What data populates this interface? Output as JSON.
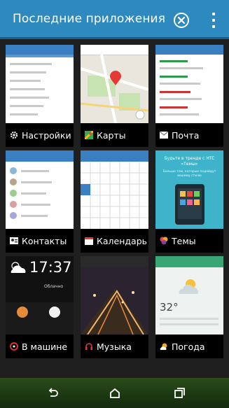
{
  "header": {
    "title": "Последние приложения",
    "close_icon": "close-circle-icon",
    "menu_icon": "more-vertical-icon"
  },
  "apps": [
    {
      "label": "Настройки",
      "icon": "settings-gear-icon",
      "accent": "#3a7fc1"
    },
    {
      "label": "Карты",
      "icon": "maps-icon",
      "accent": "#34a853"
    },
    {
      "label": "Почта",
      "icon": "mail-icon",
      "accent": "#ffffff"
    },
    {
      "label": "Контакты",
      "icon": "contacts-card-icon",
      "accent": "#ffffff"
    },
    {
      "label": "Календарь",
      "icon": "calendar-icon",
      "accent": "#ffffff"
    },
    {
      "label": "Темы",
      "icon": "themes-icon",
      "accent": "#e64a3c"
    },
    {
      "label": "В машине",
      "icon": "car-mode-icon",
      "accent": "#e53935"
    },
    {
      "label": "Музыка",
      "icon": "headphones-icon",
      "accent": "#e53935"
    },
    {
      "label": "Погода",
      "icon": "weather-icon",
      "accent": "#f6a623"
    }
  ],
  "previews": {
    "themes_banner": "Будьте в тренде с HTC «Темы»",
    "themes_sub": "Больше тем, которые подойдут вашему стилю",
    "car_time": "17:37",
    "car_weather_text": "Облачно",
    "weather_temp": "32°"
  },
  "navbar": {
    "back_icon": "back-icon",
    "home_icon": "home-icon",
    "recent_icon": "recent-apps-icon"
  }
}
